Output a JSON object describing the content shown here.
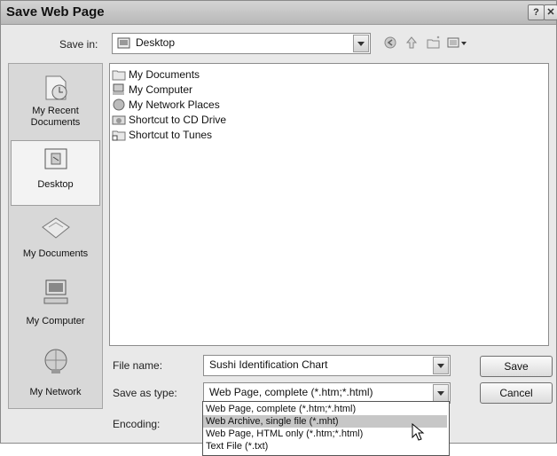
{
  "window": {
    "title": "Save Web Page",
    "help_glyph": "?",
    "close_glyph": "✕"
  },
  "save_in": {
    "label": "Save in:",
    "value": "Desktop"
  },
  "toolbar": {
    "icons": [
      "back-icon",
      "up-folder-icon",
      "new-folder-icon",
      "views-menu-icon"
    ]
  },
  "places": [
    {
      "label_line1": "My Recent",
      "label_line2": "Documents",
      "icon": "recent-documents-icon"
    },
    {
      "label_line1": "Desktop",
      "label_line2": "",
      "icon": "desktop-icon",
      "selected": true
    },
    {
      "label_line1": "My Documents",
      "label_line2": "",
      "icon": "my-documents-icon"
    },
    {
      "label_line1": "My Computer",
      "label_line2": "",
      "icon": "my-computer-icon"
    },
    {
      "label_line1": "My Network",
      "label_line2": "",
      "icon": "my-network-icon"
    }
  ],
  "files": [
    {
      "name": "My Documents",
      "icon": "folder-icon"
    },
    {
      "name": "My Computer",
      "icon": "computer-icon"
    },
    {
      "name": "My Network Places",
      "icon": "network-icon"
    },
    {
      "name": "Shortcut to CD Drive",
      "icon": "cd-shortcut-icon"
    },
    {
      "name": "Shortcut to Tunes",
      "icon": "folder-shortcut-icon"
    }
  ],
  "file_name": {
    "label": "File name:",
    "value": "Sushi Identification Chart"
  },
  "save_as_type": {
    "label": "Save as type:",
    "value": "Web Page, complete (*.htm;*.html)"
  },
  "encoding": {
    "label": "Encoding:"
  },
  "buttons": {
    "save": "Save",
    "cancel": "Cancel"
  },
  "type_options": [
    "Web Page, complete (*.htm;*.html)",
    "Web Archive, single file (*.mht)",
    "Web Page, HTML only (*.htm;*.html)",
    "Text File (*.txt)"
  ],
  "highlighted_option": "Web Archive, single file (*.mht)"
}
